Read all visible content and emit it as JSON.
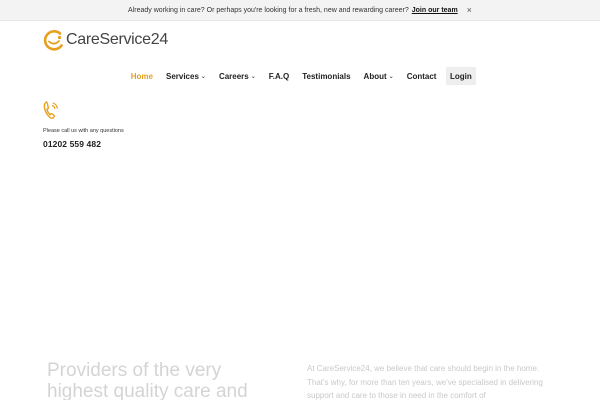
{
  "announcement": {
    "message": "Already working in care? Or perhaps you're looking for a fresh, new and rewarding career?",
    "link_label": "Join our team",
    "close_glyph": "×"
  },
  "brand": {
    "name": "CareService",
    "number": "24",
    "logo_icon": "care-c-logo-icon",
    "accent_color": "#e6a01e"
  },
  "nav": {
    "home": "Home",
    "services": "Services",
    "careers": "Careers",
    "faq": "F.A.Q",
    "testimonials": "Testimonials",
    "about": "About",
    "contact": "Contact",
    "login": "Login",
    "caret": "⌄"
  },
  "call": {
    "icon": "phone-ringing-icon",
    "note": "Please call us with any questions",
    "phone": "01202 559 482"
  },
  "hero": {
    "title": "Providers of the very highest quality care and",
    "text": "At CareService24, we believe that care should begin in the home. That's why, for more than ten years, we've specialised in delivering support and care to those in need in the comfort of"
  }
}
